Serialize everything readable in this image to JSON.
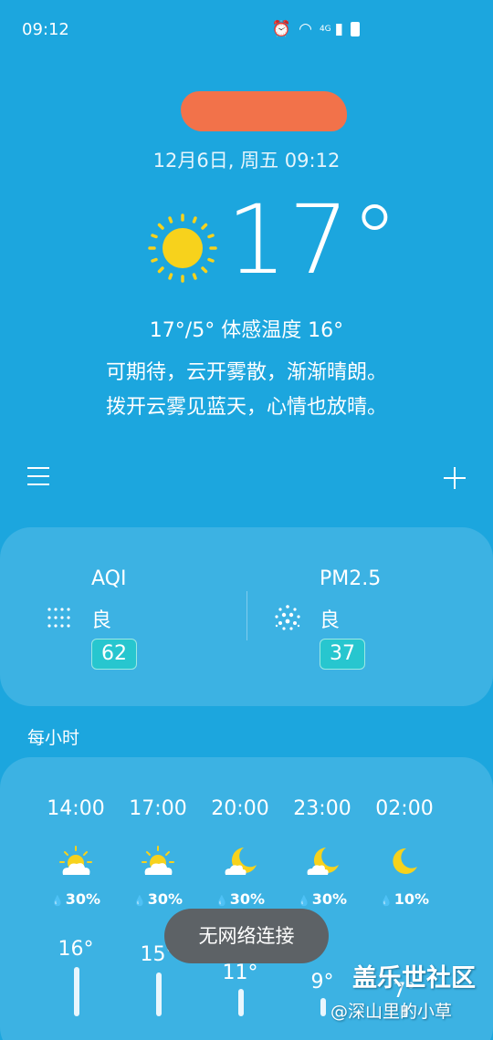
{
  "status_bar": {
    "time": "09:12",
    "icons": [
      "alarm-icon",
      "wifi-icon",
      "signal-icon",
      "battery-icon"
    ],
    "signal_label": "4G"
  },
  "header": {
    "date_time": "12月6日, 周五 09:12",
    "current_temp": "17°",
    "weather_icon": "sun-icon",
    "temp_range": "17°/5° 体感温度 16°",
    "description_line1": "可期待，云开雾散，渐渐晴朗。",
    "description_line2": "拨开云雾见蓝天，心情也放晴。"
  },
  "toolbar": {
    "menu_icon": "menu-icon",
    "add_icon": "add-icon"
  },
  "air_quality": [
    {
      "title": "AQI",
      "level": "良",
      "value": "62",
      "icon": "aqi-dots-icon"
    },
    {
      "title": "PM2.5",
      "level": "良",
      "value": "37",
      "icon": "pm25-dots-icon"
    }
  ],
  "hourly": {
    "label": "每小时",
    "items": [
      {
        "time": "14:00",
        "icon": "sun-cloud-icon",
        "precip": "30%",
        "temp": "16°"
      },
      {
        "time": "17:00",
        "icon": "sun-cloud-icon",
        "precip": "30%",
        "temp": "15°"
      },
      {
        "time": "20:00",
        "icon": "moon-cloud-icon",
        "precip": "30%",
        "temp": "11°"
      },
      {
        "time": "23:00",
        "icon": "moon-cloud-icon",
        "precip": "30%",
        "temp": "9°"
      },
      {
        "time": "02:00",
        "icon": "moon-icon",
        "precip": "10%",
        "temp": "7°"
      }
    ]
  },
  "toast": "无网络连接",
  "watermark": {
    "line1": "盖乐世社区",
    "line2": "@深山里的小草"
  },
  "colors": {
    "background": "#1ca6de",
    "card": "#3cb2e3",
    "badge": "#27c6cf",
    "sun": "#f7d21c",
    "toast": "#5d6266",
    "location_redaction": "#f2724a"
  }
}
